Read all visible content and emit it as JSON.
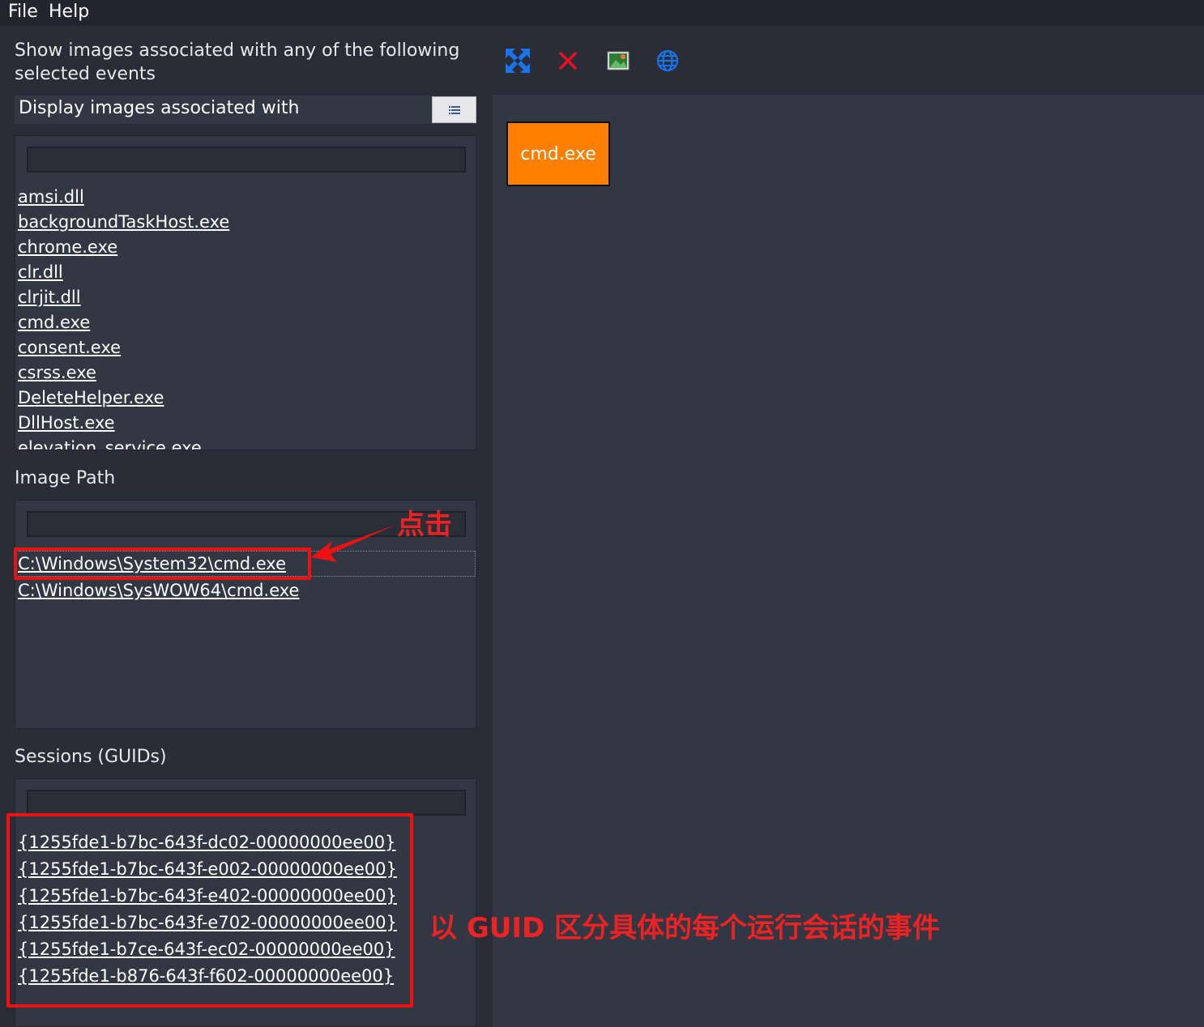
{
  "menu": {
    "file": "File",
    "help": "Help"
  },
  "filter_section": {
    "title": "Show images associated with any of the following selected events",
    "dropdown_label": "Display images associated with",
    "filter_value": "",
    "items": [
      "amsi.dll",
      "backgroundTaskHost.exe",
      "chrome.exe",
      "clr.dll",
      "clrjit.dll",
      "cmd.exe",
      "consent.exe",
      "csrss.exe",
      "DeleteHelper.exe",
      "DllHost.exe",
      "elevation_service.exe"
    ]
  },
  "image_path_section": {
    "title": "Image Path",
    "filter_value": "",
    "items": [
      "C:\\Windows\\System32\\cmd.exe",
      "C:\\Windows\\SysWOW64\\cmd.exe"
    ]
  },
  "sessions_section": {
    "title": "Sessions (GUIDs)",
    "filter_value": "",
    "items": [
      "{1255fde1-b7bc-643f-dc02-00000000ee00}",
      "{1255fde1-b7bc-643f-e002-00000000ee00}",
      "{1255fde1-b7bc-643f-e402-00000000ee00}",
      "{1255fde1-b7bc-643f-e702-00000000ee00}",
      "{1255fde1-b7ce-643f-ec02-00000000ee00}",
      "{1255fde1-b876-643f-f602-00000000ee00}"
    ]
  },
  "toolbar": {
    "icons": [
      "fit-view-icon",
      "clear-icon",
      "image-icon",
      "globe-icon"
    ],
    "colors": {
      "fit": "#1a73e8",
      "clear": "#e81123",
      "globe": "#1a73e8"
    }
  },
  "canvas": {
    "node_label": "cmd.exe",
    "node_color": "#ff7f00"
  },
  "annotations": {
    "click": "点击",
    "guid_note": "以 GUID 区分具体的每个运行会话的事件"
  }
}
